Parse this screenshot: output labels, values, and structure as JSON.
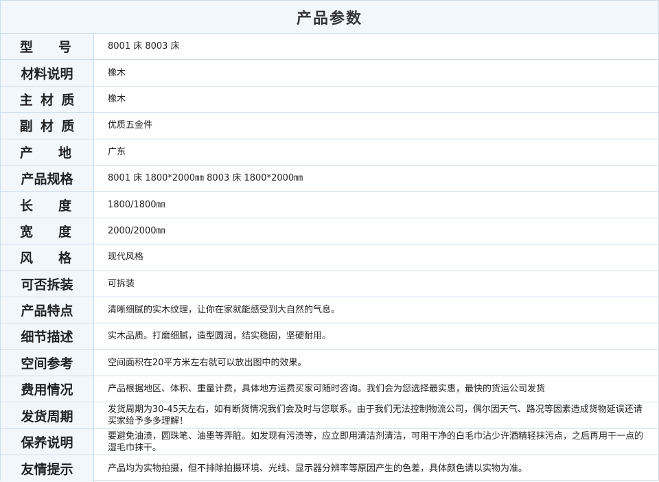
{
  "title": "产品参数",
  "rows": [
    {
      "label": "型号",
      "value": "8001 床  8003 床"
    },
    {
      "label": "材料说明",
      "value": "橡木"
    },
    {
      "label": "主材质",
      "value": "橡木"
    },
    {
      "label": "副材质",
      "value": "优质五金件"
    },
    {
      "label": "产地",
      "value": "广东"
    },
    {
      "label": "产品规格",
      "value": "8001 床 1800*2000㎜  8003 床 1800*2000㎜"
    },
    {
      "label": "长度",
      "value": "1800/1800㎜"
    },
    {
      "label": "宽度",
      "value": "2000/2000㎜"
    },
    {
      "label": "风格",
      "value": "现代风格"
    },
    {
      "label": "可否拆装",
      "value": "可拆装"
    },
    {
      "label": "产品特点",
      "value": "清晰细腻的实木纹理，让你在家就能感受到大自然的气息。"
    },
    {
      "label": "细节描述",
      "value": "实木品质。打磨细腻，造型圆润，结实稳固，坚硬耐用。"
    },
    {
      "label": "空间参考",
      "value": "空间面积在20平方米左右就可以放出图中的效果。"
    },
    {
      "label": "费用情况",
      "value": "产品根据地区、体积、重量计费，具体地方运费买家可随时咨询。我们会为您选择最实惠，最快的货运公司发货"
    },
    {
      "label": "发货周期",
      "value": "发货周期为30-45天左右，如有断货情况我们会及时与您联系。由于我们无法控制物流公司，偶尔因天气、路况等因素造成货物延误还请买家给予多多理解！"
    },
    {
      "label": "保养说明",
      "value": "要避免油渍，圆珠笔、油墨等弄脏。如发现有污渍等，应立即用清洁剂清洁，可用干净的白毛巾沾少许酒精轻抹污点，之后再用干一点的湿毛巾抹干。"
    },
    {
      "label": "友情提示",
      "value": "产品均为实物拍摄，但不排除拍摄环境、光线、显示器分辨率等原因产生的色差，具体颜色请以实物为准。"
    }
  ]
}
